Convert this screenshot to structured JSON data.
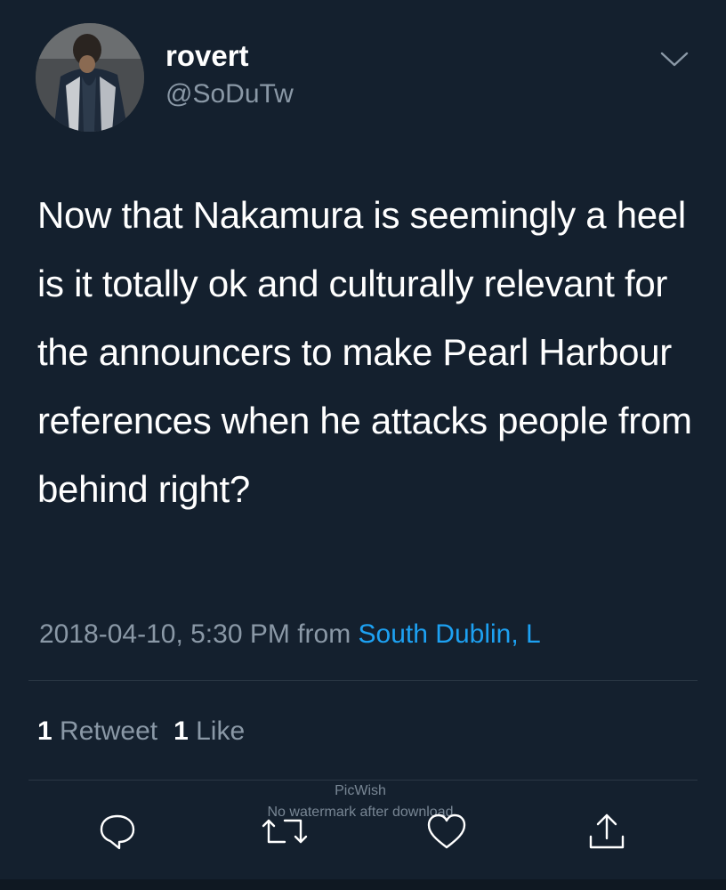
{
  "user": {
    "name": "rovert",
    "handle": "@SoDuTw"
  },
  "tweet": {
    "text": "Now that Nakamura is seemingly a heel is it totally ok and culturally relevant for the announcers to make Pearl Harbour references when he attacks people from behind right?",
    "timestamp": "2018-04-10, 5:30 PM",
    "from_label": "from",
    "location": "South Dublin, L"
  },
  "stats": {
    "retweets_count": "1",
    "retweets_label": "Retweet",
    "likes_count": "1",
    "likes_label": "Like"
  },
  "watermark": {
    "line1": "PicWish",
    "line2": "No watermark after download"
  },
  "colors": {
    "background": "#14202e",
    "accent": "#1da1f2",
    "secondary_text": "#8a98a6"
  },
  "icons": {
    "menu": "chevron-down-icon",
    "reply": "reply-icon",
    "retweet": "retweet-icon",
    "like": "heart-icon",
    "share": "share-icon"
  }
}
